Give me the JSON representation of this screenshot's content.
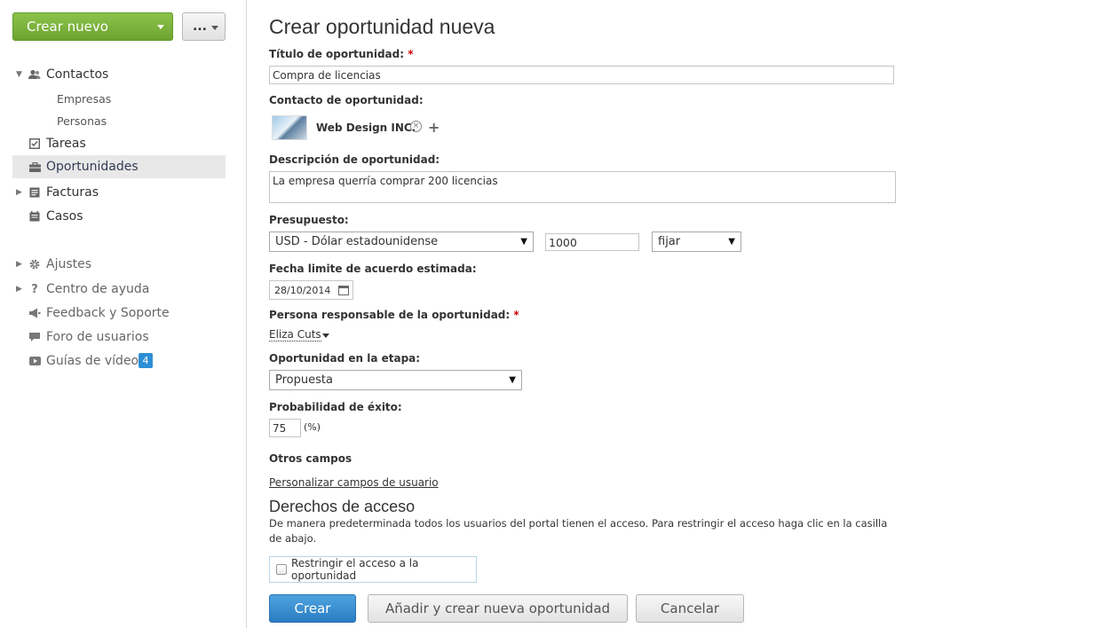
{
  "sidebar": {
    "create_label": "Crear nuevo",
    "more_label": "...",
    "items": [
      {
        "label": "Contactos",
        "icon": "contacts-icon"
      },
      {
        "label": "Empresas"
      },
      {
        "label": "Personas"
      },
      {
        "label": "Tareas",
        "icon": "tasks-icon"
      },
      {
        "label": "Oportunidades",
        "icon": "briefcase-icon"
      },
      {
        "label": "Facturas",
        "icon": "invoices-icon"
      },
      {
        "label": "Casos",
        "icon": "cases-icon"
      },
      {
        "label": "Ajustes",
        "icon": "gear-icon"
      },
      {
        "label": "Centro de ayuda",
        "icon": "help-icon"
      },
      {
        "label": "Feedback y Soporte",
        "icon": "megaphone-icon"
      },
      {
        "label": "Foro de usuarios",
        "icon": "chat-icon"
      },
      {
        "label": "Guías de vídeo",
        "icon": "video-icon",
        "badge": "4"
      }
    ]
  },
  "main": {
    "title": "Crear oportunidad nueva",
    "opportunity_title": {
      "label": "Título de oportunidad:",
      "required": "*",
      "value": "Compra de licencias"
    },
    "contact": {
      "label": "Contacto de oportunidad:",
      "name": "Web Design INC.",
      "remove_glyph": "×",
      "add_glyph": "+"
    },
    "description": {
      "label": "Descripción de oportunidad:",
      "value": "La empresa querría comprar 200 licencias"
    },
    "budget": {
      "label": "Presupuesto:",
      "currency": "USD - Dólar estadounidense",
      "amount": "1000",
      "type": "fijar"
    },
    "deadline": {
      "label": "Fecha limite de acuerdo estimada:",
      "value": "28/10/2014"
    },
    "owner": {
      "label": "Persona responsable de la oportunidad:",
      "required": "*",
      "value": "Eliza Cuts"
    },
    "stage": {
      "label": "Oportunidad en la etapa:",
      "value": "Propuesta"
    },
    "probability": {
      "label": "Probabilidad de éxito:",
      "value": "75",
      "unit": "(%)"
    },
    "other_fields": {
      "label": "Otros campos",
      "link": "Personalizar campos de usuario"
    },
    "access": {
      "title": "Derechos de acceso",
      "note": "De manera predeterminada todos los usuarios del portal tienen el acceso. Para restringir el acceso haga clic en la casilla de abajo.",
      "restrict_label": "Restringir el acceso a la oportunidad"
    },
    "buttons": {
      "create": "Crear",
      "add_new": "Añadir y crear nueva oportunidad",
      "cancel": "Cancelar"
    },
    "dropdown_glyph": "▼"
  },
  "colors": {
    "accent": "#2b7dc2",
    "create_green": "#6da32f",
    "badge": "#2d8ed6",
    "required": "#cc0000"
  }
}
